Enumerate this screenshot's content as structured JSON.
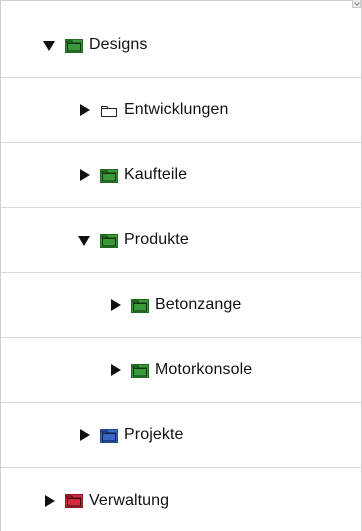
{
  "tree": [
    {
      "label": "Designs",
      "expanded": true,
      "level": 0,
      "folder_color": "#3a9a3a",
      "icon": "folder-open-icon"
    },
    {
      "label": "Entwicklungen",
      "expanded": false,
      "level": 1,
      "folder_color": "#ffffff",
      "icon": "folder-outline-icon"
    },
    {
      "label": "Kaufteile",
      "expanded": false,
      "level": 1,
      "folder_color": "#3a9a3a",
      "icon": "folder-icon"
    },
    {
      "label": "Produkte",
      "expanded": true,
      "level": 1,
      "folder_color": "#3a9a3a",
      "icon": "folder-icon"
    },
    {
      "label": "Betonzange",
      "expanded": false,
      "level": 2,
      "folder_color": "#3a9a3a",
      "icon": "folder-icon"
    },
    {
      "label": "Motorkonsole",
      "expanded": false,
      "level": 2,
      "folder_color": "#3a9a3a",
      "icon": "folder-icon"
    },
    {
      "label": "Projekte",
      "expanded": false,
      "level": 1,
      "folder_color": "#3a67c2",
      "icon": "folder-icon"
    },
    {
      "label": "Verwaltung",
      "expanded": false,
      "level": 0,
      "folder_color": "#d12a3a",
      "icon": "folder-icon"
    }
  ]
}
